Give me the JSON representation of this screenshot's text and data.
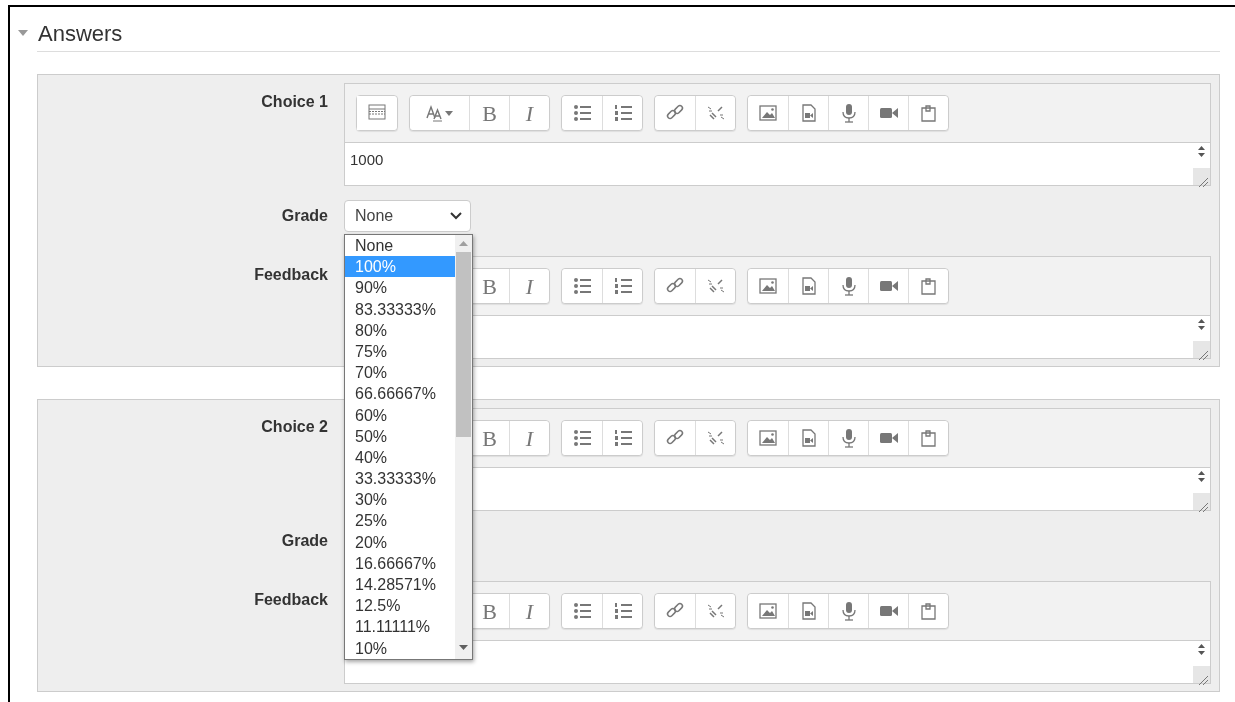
{
  "section": {
    "title": "Answers",
    "expanded": true
  },
  "toolbar": [
    [
      {
        "kind": "table"
      }
    ],
    [
      {
        "kind": "font"
      },
      {
        "kind": "bold"
      },
      {
        "kind": "italic"
      }
    ],
    [
      {
        "kind": "bullets"
      },
      {
        "kind": "numbers"
      }
    ],
    [
      {
        "kind": "link"
      },
      {
        "kind": "unlink"
      }
    ],
    [
      {
        "kind": "image"
      },
      {
        "kind": "videofile"
      },
      {
        "kind": "mic"
      },
      {
        "kind": "camera"
      },
      {
        "kind": "files"
      }
    ]
  ],
  "choices": [
    {
      "label": "Choice 1",
      "editor": {
        "bold": "B",
        "italic": "I",
        "text": "1000"
      },
      "grade_label": "Grade",
      "grade": {
        "value": "None",
        "open": true
      },
      "feedback_label": "Feedback",
      "feedback_editor": {
        "bold": "B",
        "italic": "I"
      }
    },
    {
      "label": "Choice 2",
      "editor": {
        "bold": "B",
        "italic": "I"
      },
      "grade_label": "Grade",
      "feedback_label": "Feedback",
      "feedback_editor": {
        "bold": "B",
        "italic": "I"
      }
    }
  ],
  "grade_options": [
    {
      "label": "None",
      "selected": false
    },
    {
      "label": "100%",
      "selected": true
    },
    {
      "label": "90%",
      "selected": false
    },
    {
      "label": "83.33333%",
      "selected": false
    },
    {
      "label": "80%",
      "selected": false
    },
    {
      "label": "75%",
      "selected": false
    },
    {
      "label": "70%",
      "selected": false
    },
    {
      "label": "66.66667%",
      "selected": false
    },
    {
      "label": "60%",
      "selected": false
    },
    {
      "label": "50%",
      "selected": false
    },
    {
      "label": "40%",
      "selected": false
    },
    {
      "label": "33.33333%",
      "selected": false
    },
    {
      "label": "30%",
      "selected": false
    },
    {
      "label": "25%",
      "selected": false
    },
    {
      "label": "20%",
      "selected": false
    },
    {
      "label": "16.66667%",
      "selected": false
    },
    {
      "label": "14.28571%",
      "selected": false
    },
    {
      "label": "12.5%",
      "selected": false
    },
    {
      "label": "11.11111%",
      "selected": false
    },
    {
      "label": "10%",
      "selected": false
    }
  ]
}
